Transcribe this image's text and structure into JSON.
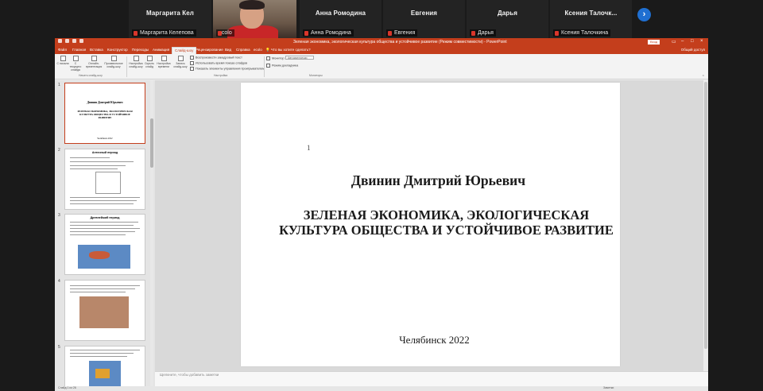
{
  "participants": [
    {
      "display": "Маргарита  Кел",
      "label": "Маргарита Келепова"
    },
    {
      "display": "",
      "label": "ecolo"
    },
    {
      "display": "Анна Ромодина",
      "label": "Анна Ромодина"
    },
    {
      "display": "Евгения",
      "label": "Евгения"
    },
    {
      "display": "Дарья",
      "label": "Дарья"
    },
    {
      "display": "Ксения  Талочк...",
      "label": "Ксения Талочкина"
    }
  ],
  "next_arrow": "›",
  "app": {
    "window_title": "Зеленая экономика, экологическая культура общества и устойчивое развитие (Режим совместимости) - PowerPoint",
    "signin": "Вход",
    "share": "Общий доступ",
    "tell_me": "Что вы хотите сделать?",
    "tabs": [
      "Файл",
      "Главная",
      "Вставка",
      "Конструктор",
      "Переходы",
      "Анимация",
      "Слайд-шоу",
      "Рецензирование",
      "Вид",
      "Справка",
      "ecolo"
    ],
    "active_tab": "Слайд-шоу"
  },
  "ribbon": {
    "buttons": [
      "С начала",
      "С текущего слайда",
      "Онлайн-презентация",
      "Произвольное слайд-шоу",
      "Настройка слайд-шоу",
      "Скрыть слайд",
      "Настройка времени",
      "Запись слайд-шоу"
    ],
    "checks": [
      "Воспроизвести закадровый текст",
      "Использовать время показа слайдов",
      "Показать элементы управления проигрывателем"
    ],
    "monitor_checks": [
      "Монитор:",
      "Режим докладчика"
    ],
    "monitor_value": "Автоматически",
    "groups": [
      "Начать слайд-шоу",
      "Настройка",
      "Мониторы"
    ]
  },
  "thumbnails": [
    {
      "num": "1",
      "title": "Двинин Дмитрий Юрьевич",
      "subtitle": "ЗЕЛЕНАЯ ЭКОНОМИКА, ЭКОЛОГИЧЕСКАЯ КУЛЬТУРА ОБЩЕСТВА И УСТОЙЧИВОЕ РАЗВИТИЕ",
      "footer": "Челябинск 2022"
    },
    {
      "num": "2",
      "title": "Античный период"
    },
    {
      "num": "3",
      "title": "Древнейший период"
    },
    {
      "num": "4",
      "title": ""
    },
    {
      "num": "5",
      "title": ""
    }
  ],
  "slide": {
    "number": "1",
    "author": "Двинин Дмитрий Юрьевич",
    "title": "ЗЕЛЕНАЯ ЭКОНОМИКА, ЭКОЛОГИЧЕСКАЯ КУЛЬТУРА ОБЩЕСТВА И УСТОЙЧИВОЕ РАЗВИТИЕ",
    "city": "Челябинск 2022"
  },
  "notes_placeholder": "Щелкните, чтобы добавить заметки",
  "status": {
    "left": "Слайд 1 из 26",
    "right": "Заметки"
  },
  "colors": {
    "accent": "#c43e1c",
    "zoom_button": "#1f6fd1",
    "shirt": "#c82628"
  }
}
